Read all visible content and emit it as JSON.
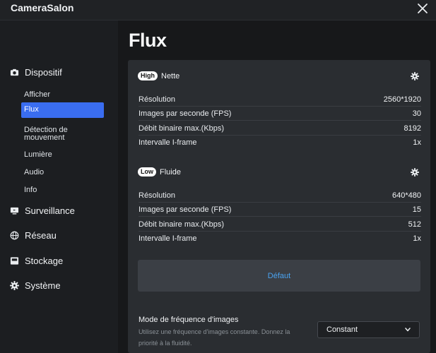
{
  "app": {
    "title": "CameraSalon"
  },
  "sidebar": {
    "sections": [
      {
        "label": "Dispositif",
        "icon": "camera-icon"
      },
      {
        "label": "Surveillance",
        "icon": "monitor-icon"
      },
      {
        "label": "Réseau",
        "icon": "globe-icon"
      },
      {
        "label": "Stockage",
        "icon": "storage-icon"
      },
      {
        "label": "Système",
        "icon": "gear-icon"
      }
    ],
    "dispositif_items": [
      {
        "label": "Afficher",
        "active": false
      },
      {
        "label": "Flux",
        "active": true
      },
      {
        "label": "Détection de mouvement",
        "active": false
      },
      {
        "label": "Lumière",
        "active": false
      },
      {
        "label": "Audio",
        "active": false
      },
      {
        "label": "Info",
        "active": false
      }
    ]
  },
  "main": {
    "title": "Flux",
    "streams": [
      {
        "badge": "High",
        "name": "Nette",
        "rows": [
          {
            "label": "Résolution",
            "value": "2560*1920"
          },
          {
            "label": "Images par seconde (FPS)",
            "value": "30"
          },
          {
            "label": "Débit binaire max.(Kbps)",
            "value": "8192"
          },
          {
            "label": "Intervalle I-frame",
            "value": "1x"
          }
        ]
      },
      {
        "badge": "Low",
        "name": "Fluide",
        "rows": [
          {
            "label": "Résolution",
            "value": "640*480"
          },
          {
            "label": "Images par seconde (FPS)",
            "value": "15"
          },
          {
            "label": "Débit binaire max.(Kbps)",
            "value": "512"
          },
          {
            "label": "Intervalle I-frame",
            "value": "1x"
          }
        ]
      }
    ],
    "default_button": "Défaut",
    "frame_rate_mode": {
      "title": "Mode de fréquence d'images",
      "description": "Utilisez une fréquence d'images constante. Donnez la priorité à la fluidité.",
      "selected": "Constant"
    }
  },
  "colors": {
    "accent": "#3a6df0",
    "link": "#4aa3f0"
  }
}
